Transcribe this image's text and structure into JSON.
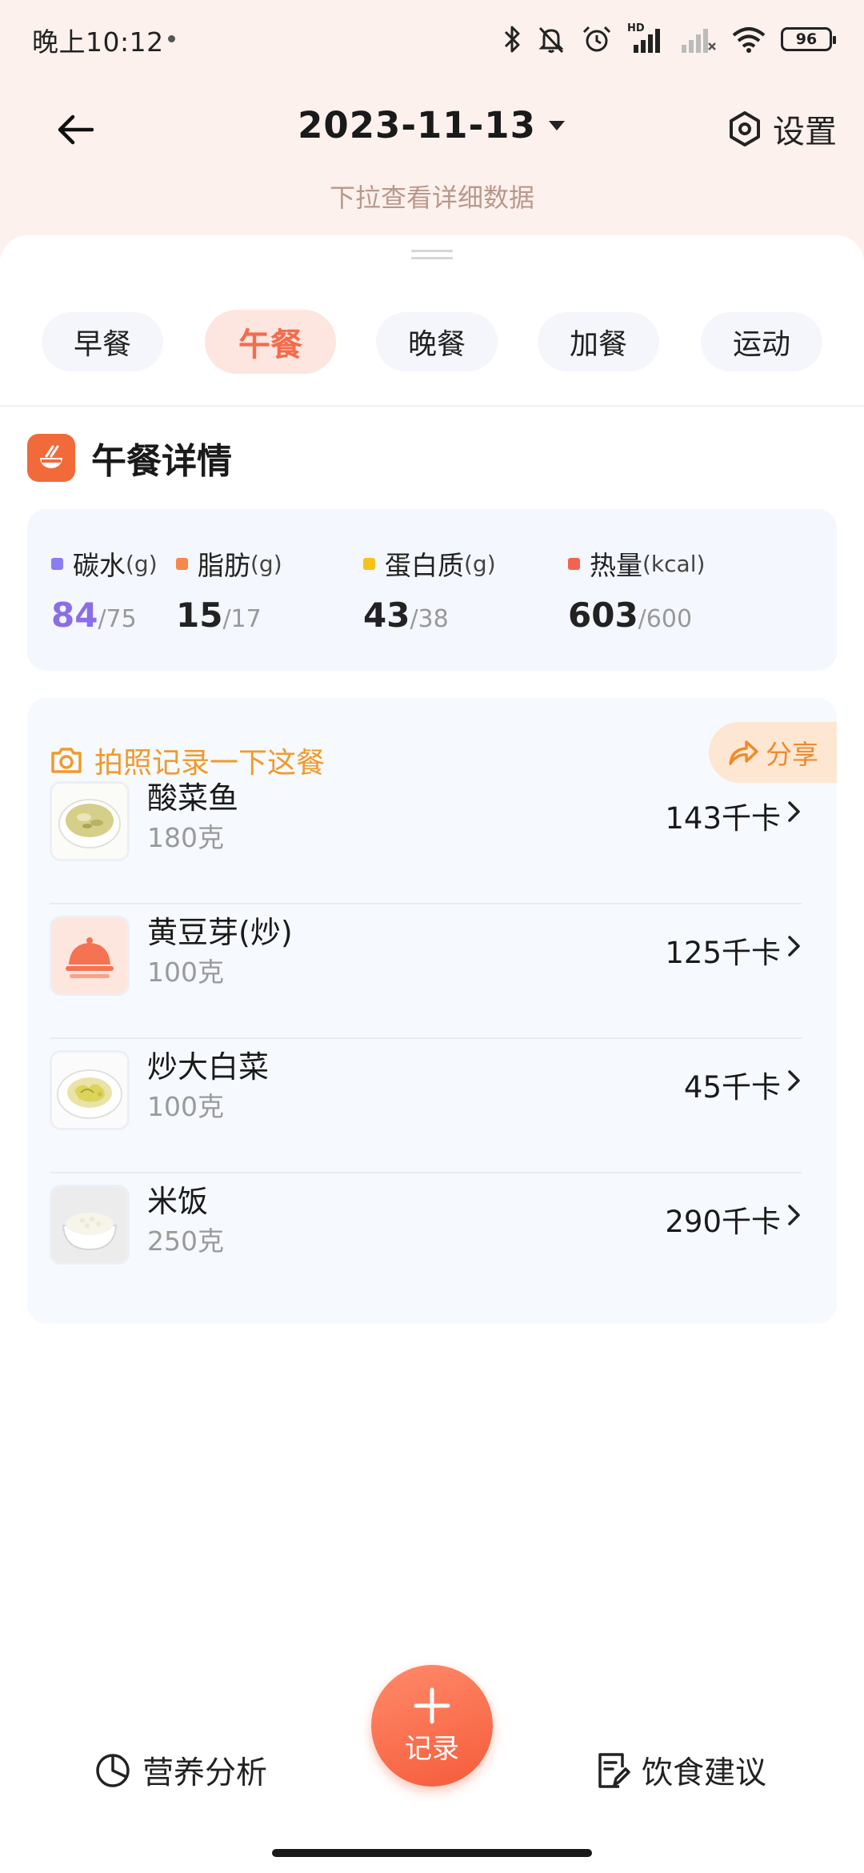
{
  "status_bar": {
    "time": "晚上10:12",
    "hd_label": "HD",
    "battery": "96"
  },
  "header": {
    "date": "2023-11-13",
    "settings_label": "设置",
    "pull_hint": "下拉查看详细数据"
  },
  "meal_tabs": [
    {
      "label": "早餐",
      "active": false
    },
    {
      "label": "午餐",
      "active": true
    },
    {
      "label": "晚餐",
      "active": false
    },
    {
      "label": "加餐",
      "active": false
    },
    {
      "label": "运动",
      "active": false
    }
  ],
  "section": {
    "title": "午餐详情"
  },
  "macros": [
    {
      "name": "碳水",
      "unit": "(g)",
      "value": "84",
      "target": "/75",
      "color": "#8b7cf0",
      "value_color": "#8b6ee6"
    },
    {
      "name": "脂肪",
      "unit": "(g)",
      "value": "15",
      "target": "/17",
      "color": "#f8874a",
      "value_color": "#222222"
    },
    {
      "name": "蛋白质",
      "unit": "(g)",
      "value": "43",
      "target": "/38",
      "color": "#f7c21a",
      "value_color": "#222222"
    },
    {
      "name": "热量",
      "unit": "(kcal)",
      "value": "603",
      "target": "/600",
      "color": "#f2644c",
      "value_color": "#222222"
    }
  ],
  "food_card": {
    "photo_prompt": "拍照记录一下这餐",
    "share_label": "分享",
    "items": [
      {
        "name": "酸菜鱼",
        "weight": "180克",
        "kcal": "143千卡",
        "thumb": "soup-bowl"
      },
      {
        "name": "黄豆芽(炒)",
        "weight": "100克",
        "kcal": "125千卡",
        "thumb": "dish-cover-placeholder"
      },
      {
        "name": "炒大白菜",
        "weight": "100克",
        "kcal": "45千卡",
        "thumb": "cabbage-plate"
      },
      {
        "name": "米饭",
        "weight": "250克",
        "kcal": "290千卡",
        "thumb": "rice-bowl"
      }
    ]
  },
  "bottom_nav": {
    "nutrition_label": "营养分析",
    "record_label": "记录",
    "diet_label": "饮食建议"
  }
}
